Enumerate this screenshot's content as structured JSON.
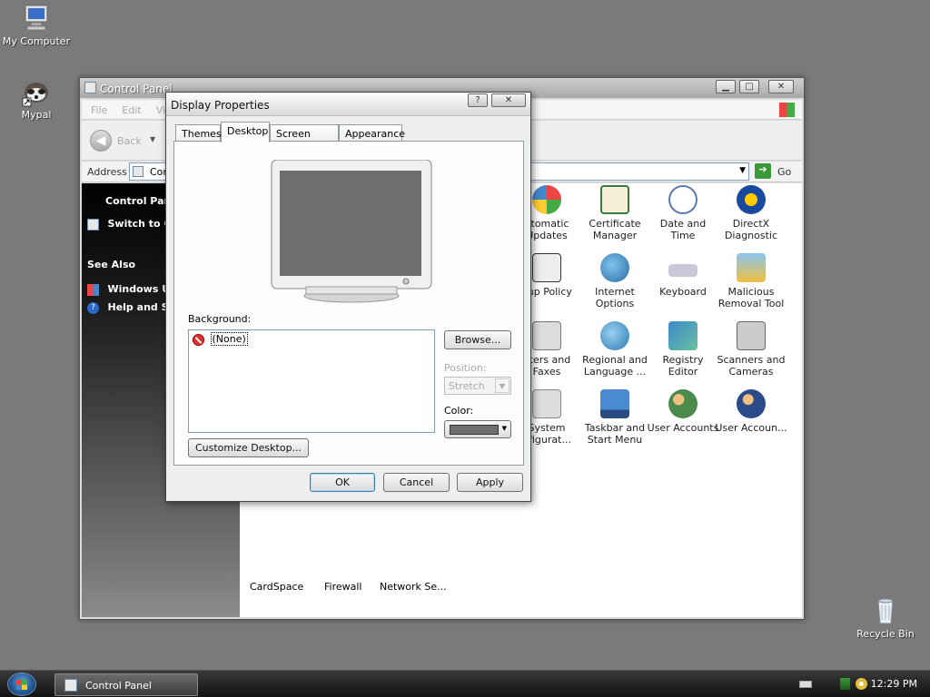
{
  "desktop": {
    "icons": [
      {
        "label": "My Computer"
      },
      {
        "label": "Mypal"
      },
      {
        "label": "Recycle Bin"
      }
    ]
  },
  "control_panel": {
    "title": "Control Panel",
    "menu": [
      "File",
      "Edit",
      "Vi"
    ],
    "back_label": "Back",
    "address_label": "Address",
    "address_value": "Con",
    "go_label": "Go",
    "side": {
      "heading": "Control Pane",
      "switch_label": "Switch to Ca",
      "see_also": "See Also",
      "links": [
        "Windows Up",
        "Help and Sup"
      ]
    },
    "items": [
      {
        "label": "utomatic Updates"
      },
      {
        "label": "Certificate Manager"
      },
      {
        "label": "Date and Time"
      },
      {
        "label": "DirectX Diagnostic"
      },
      {
        "label": "oup Policy"
      },
      {
        "label": "Internet Options"
      },
      {
        "label": "Keyboard"
      },
      {
        "label": "Malicious Removal Tool"
      },
      {
        "label": "nters and Faxes"
      },
      {
        "label": "Regional and Language ..."
      },
      {
        "label": "Registry Editor"
      },
      {
        "label": "Scanners and Cameras"
      },
      {
        "label": "System nfigurat..."
      },
      {
        "label": "Taskbar and Start Menu"
      },
      {
        "label": "User Accounts"
      },
      {
        "label": "User Accoun..."
      }
    ],
    "bottom_items": [
      "CardSpace",
      "Firewall",
      "Network Se..."
    ]
  },
  "dialog": {
    "title": "Display Properties",
    "help_glyph": "?",
    "close_glyph": "✕",
    "tabs": [
      "Themes",
      "Desktop",
      "Screen Saver",
      "Appearance"
    ],
    "active_tab": "Desktop",
    "background_label": "Background:",
    "background_items": [
      "(None)"
    ],
    "browse_label": "Browse...",
    "position_label": "Position:",
    "position_value": "Stretch",
    "color_label": "Color:",
    "color_value": "#6e6e6e",
    "customize_label": "Customize Desktop...",
    "ok_label": "OK",
    "cancel_label": "Cancel",
    "apply_label": "Apply"
  },
  "taskbar": {
    "task_label": "Control Panel",
    "clock": "12:29 PM"
  },
  "colors": {
    "desktop_bg": "#7a7a7a",
    "accent": "#3c7fb1"
  }
}
